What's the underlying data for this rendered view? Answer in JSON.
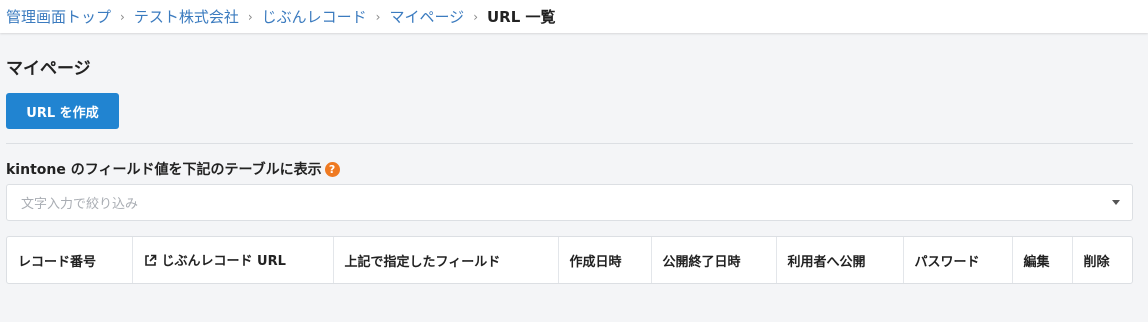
{
  "breadcrumb": {
    "items": [
      "管理画面トップ",
      "テスト株式会社",
      "じぶんレコード",
      "マイページ"
    ],
    "current": "URL 一覧",
    "separator": "›"
  },
  "page": {
    "title": "マイページ",
    "create_button": "URL を作成"
  },
  "field_section": {
    "label": "kintone のフィールド値を下記のテーブルに表示",
    "help_icon": "question-circle-icon",
    "filter_placeholder": "文字入力で絞り込み"
  },
  "table": {
    "columns": [
      "レコード番号",
      "じぶんレコード URL",
      "上記で指定したフィールド",
      "作成日時",
      "公開終了日時",
      "利用者へ公開",
      "パスワード",
      "編集",
      "削除"
    ],
    "rows": []
  },
  "colors": {
    "primary_button": "#2184d1",
    "link": "#3b7bbf",
    "help_icon": "#ef7a22"
  }
}
